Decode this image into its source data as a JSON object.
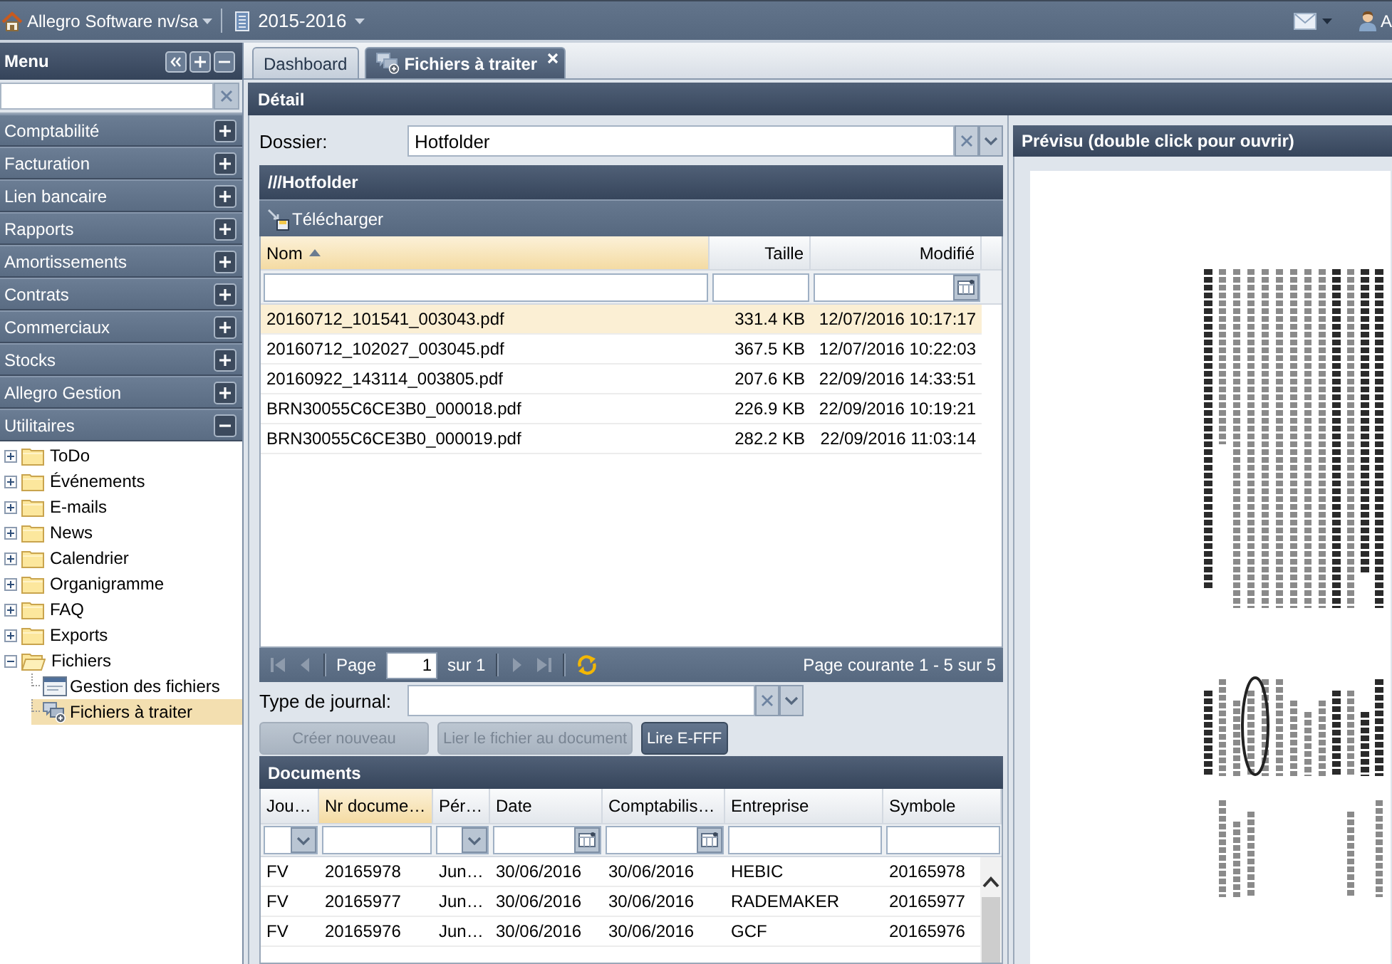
{
  "top_bar": {
    "company": "Allegro Software nv/sa",
    "fiscal_year": "2015-2016",
    "user": "A"
  },
  "sidebar": {
    "title": "Menu",
    "sections": [
      {
        "label": "Comptabilité",
        "expanded": false
      },
      {
        "label": "Facturation",
        "expanded": false
      },
      {
        "label": "Lien bancaire",
        "expanded": false
      },
      {
        "label": "Rapports",
        "expanded": false
      },
      {
        "label": "Amortissements",
        "expanded": false
      },
      {
        "label": "Contrats",
        "expanded": false
      },
      {
        "label": "Commerciaux",
        "expanded": false
      },
      {
        "label": "Stocks",
        "expanded": false
      },
      {
        "label": "Allegro Gestion",
        "expanded": false
      },
      {
        "label": "Utilitaires",
        "expanded": true,
        "children": [
          {
            "label": "ToDo",
            "kind": "folder",
            "expanded": false,
            "selected": false
          },
          {
            "label": "Événements",
            "kind": "folder",
            "expanded": false,
            "selected": false
          },
          {
            "label": "E-mails",
            "kind": "folder",
            "expanded": false,
            "selected": false
          },
          {
            "label": "News",
            "kind": "folder",
            "expanded": false,
            "selected": false
          },
          {
            "label": "Calendrier",
            "kind": "folder",
            "expanded": false,
            "selected": false
          },
          {
            "label": "Organigramme",
            "kind": "folder",
            "expanded": false,
            "selected": false
          },
          {
            "label": "FAQ",
            "kind": "folder",
            "expanded": false,
            "selected": false
          },
          {
            "label": "Exports",
            "kind": "folder",
            "expanded": false,
            "selected": false
          },
          {
            "label": "Fichiers",
            "kind": "folder",
            "expanded": true,
            "selected": false,
            "children": [
              {
                "label": "Gestion des fichiers",
                "kind": "window",
                "selected": false
              },
              {
                "label": "Fichiers à traiter",
                "kind": "chat",
                "selected": true
              }
            ]
          }
        ]
      }
    ]
  },
  "tabs": [
    {
      "label": "Dashboard",
      "kind": "plain",
      "selected": false,
      "closable": false
    },
    {
      "label": "Fichiers à traiter",
      "kind": "files",
      "selected": true,
      "closable": true
    }
  ],
  "detail": {
    "title": "Détail",
    "folder": {
      "label": "Dossier:",
      "value": "Hotfolder"
    },
    "files": {
      "title": "///Hotfolder",
      "download": "Télécharger",
      "columns": [
        {
          "label": "Nom",
          "kind": "text",
          "highlighted": true,
          "sorted": true
        },
        {
          "label": "Taille",
          "kind": "text",
          "highlighted": false,
          "sorted": false
        },
        {
          "label": "Modifié",
          "kind": "date",
          "highlighted": false,
          "sorted": false
        }
      ],
      "rows": [
        {
          "cells": [
            "20160712_101541_003043.pdf",
            "331.4 KB",
            "12/07/2016 10:17:17"
          ],
          "selected": true
        },
        {
          "cells": [
            "20160712_102027_003045.pdf",
            "367.5 KB",
            "12/07/2016 10:22:03"
          ],
          "selected": false
        },
        {
          "cells": [
            "20160922_143114_003805.pdf",
            "207.6 KB",
            "22/09/2016 14:33:51"
          ],
          "selected": false
        },
        {
          "cells": [
            "BRN30055C6CE3B0_000018.pdf",
            "226.9 KB",
            "22/09/2016 10:19:21"
          ],
          "selected": false
        },
        {
          "cells": [
            "BRN30055C6CE3B0_000019.pdf",
            "282.2 KB",
            "22/09/2016 11:03:14"
          ],
          "selected": false
        }
      ],
      "pager": {
        "page_label": "Page",
        "page": "1",
        "of": "sur 1",
        "summary": "Page courante 1 - 5 sur 5"
      }
    },
    "journal_type": {
      "label": "Type de journal:"
    },
    "buttons": [
      {
        "label": "Créer nouveau",
        "disabled": true
      },
      {
        "label": "Lier le fichier au document",
        "disabled": true
      },
      {
        "label": "Lire E-FFF",
        "disabled": false
      }
    ],
    "documents": {
      "title": "Documents",
      "columns": [
        {
          "label": "Jou…",
          "kind": "select",
          "highlighted": false
        },
        {
          "label": "Nr docume…",
          "kind": "text",
          "highlighted": true
        },
        {
          "label": "Pér…",
          "kind": "select",
          "highlighted": false
        },
        {
          "label": "Date",
          "kind": "date",
          "highlighted": false
        },
        {
          "label": "Comptabilis…",
          "kind": "date",
          "highlighted": false
        },
        {
          "label": "Entreprise",
          "kind": "text",
          "highlighted": false
        },
        {
          "label": "Symbole",
          "kind": "text",
          "highlighted": false
        }
      ],
      "rows": [
        [
          "FV",
          "20165978",
          "Jun…",
          "30/06/2016",
          "30/06/2016",
          "HEBIC",
          "20165978"
        ],
        [
          "FV",
          "20165977",
          "Jun…",
          "30/06/2016",
          "30/06/2016",
          "RADEMAKER",
          "20165977"
        ],
        [
          "FV",
          "20165976",
          "Jun…",
          "30/06/2016",
          "30/06/2016",
          "GCF",
          "20165976"
        ]
      ]
    }
  },
  "preview": {
    "title": "Prévisu (double click pour ouvrir)"
  }
}
